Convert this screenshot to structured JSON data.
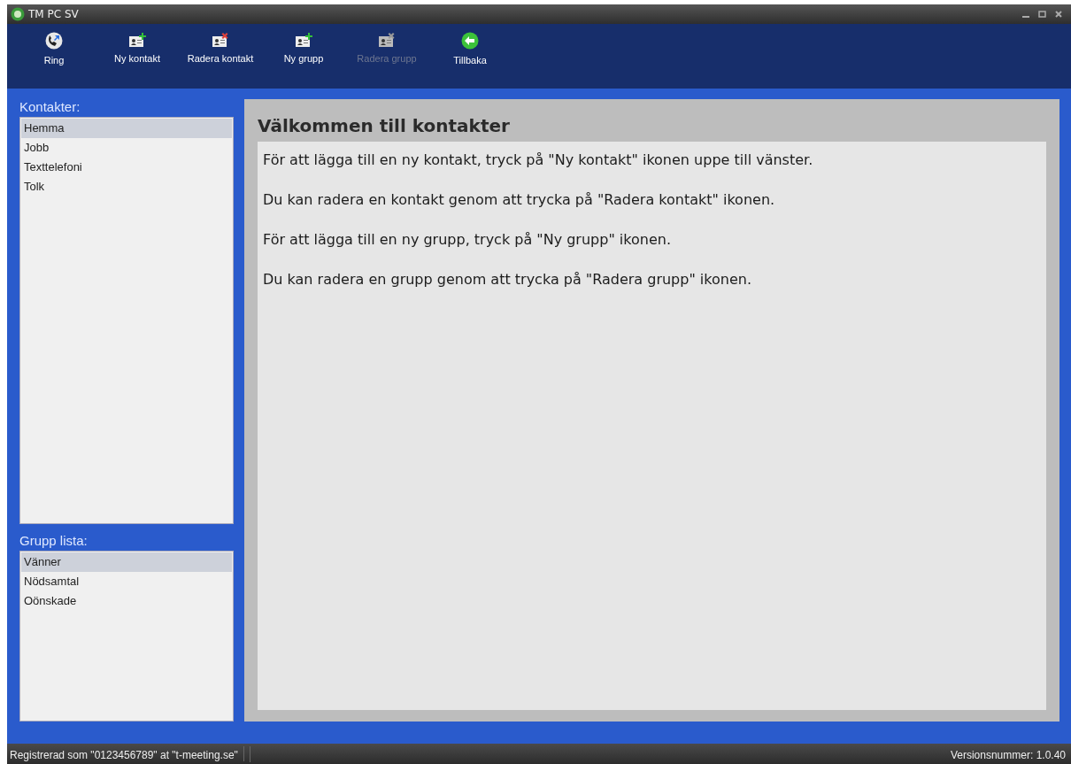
{
  "window": {
    "title": "TM PC SV"
  },
  "toolbar": [
    {
      "label": "Ring",
      "kind": "phone",
      "disabled": false
    },
    {
      "label": "Ny kontakt",
      "kind": "card-add",
      "disabled": false
    },
    {
      "label": "Radera kontakt",
      "kind": "card-remove",
      "disabled": false
    },
    {
      "label": "Ny grupp",
      "kind": "card-add",
      "disabled": false
    },
    {
      "label": "Radera grupp",
      "kind": "card-remove",
      "disabled": true
    },
    {
      "label": "Tillbaka",
      "kind": "back",
      "disabled": false
    }
  ],
  "contacts": {
    "label": "Kontakter:",
    "items": [
      {
        "label": "Hemma",
        "selected": true
      },
      {
        "label": "Jobb",
        "selected": false
      },
      {
        "label": "Texttelefoni",
        "selected": false
      },
      {
        "label": "Tolk",
        "selected": false
      }
    ]
  },
  "groups": {
    "label": "Grupp lista:",
    "items": [
      {
        "label": "Vänner",
        "selected": true
      },
      {
        "label": "Nödsamtal",
        "selected": false
      },
      {
        "label": "Oönskade",
        "selected": false
      }
    ]
  },
  "content": {
    "title": "Välkommen till kontakter",
    "paragraphs": [
      "För att lägga till en ny kontakt, tryck på \"Ny kontakt\" ikonen uppe till vänster.",
      "Du kan radera en kontakt genom att trycka på \"Radera kontakt\" ikonen.",
      "För att lägga till en ny grupp, tryck på \"Ny grupp\" ikonen.",
      "Du kan radera en grupp genom att trycka på \"Radera grupp\" ikonen."
    ]
  },
  "status_bar": {
    "left": "Registrerad som \"0123456789\" at \"t-meeting.se\"",
    "right": "Versionsnummer: 1.0.40"
  }
}
